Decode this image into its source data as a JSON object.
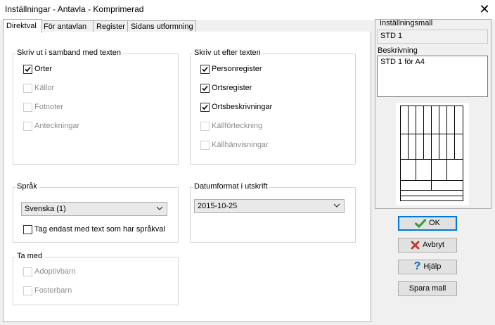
{
  "window": {
    "title": "Inställningar - Antavla - Komprimerad"
  },
  "tabs": [
    "Direktval",
    "För antavlan",
    "Register",
    "Sidans utformning"
  ],
  "groups": {
    "samband": {
      "label": "Skriv ut i samband med texten",
      "items": [
        {
          "label": "Orter",
          "checked": true,
          "enabled": true
        },
        {
          "label": "Källor",
          "checked": false,
          "enabled": false
        },
        {
          "label": "Fotnoter",
          "checked": false,
          "enabled": false
        },
        {
          "label": "Anteckningar",
          "checked": false,
          "enabled": false
        }
      ]
    },
    "efter": {
      "label": "Skriv ut efter texten",
      "items": [
        {
          "label": "Personregister",
          "checked": true,
          "enabled": true
        },
        {
          "label": "Ortsregister",
          "checked": true,
          "enabled": true
        },
        {
          "label": "Ortsbeskrivningar",
          "checked": true,
          "enabled": true
        },
        {
          "label": "Källförteckning",
          "checked": false,
          "enabled": false
        },
        {
          "label": "Källhänvisningar",
          "checked": false,
          "enabled": false
        }
      ]
    },
    "sprak": {
      "label": "Språk",
      "selected": "Svenska (1)",
      "checkbox": {
        "label": "Tag endast med text som har språkval",
        "checked": false,
        "enabled": true
      }
    },
    "datum": {
      "label": "Datumformat i utskrift",
      "selected": "2015-10-25"
    },
    "tamed": {
      "label": "Ta med",
      "items": [
        {
          "label": "Adoptivbarn",
          "checked": false,
          "enabled": false
        },
        {
          "label": "Fosterbarn",
          "checked": false,
          "enabled": false
        }
      ]
    }
  },
  "template": {
    "label": "Inställningsmall",
    "value": "STD 1",
    "desc_label": "Beskrivning",
    "desc_value": "STD 1 för A4"
  },
  "buttons": {
    "ok": "OK",
    "cancel": "Avbryt",
    "help": "Hjälp",
    "save": "Spara mall"
  },
  "colors": {
    "ok_check": "#2e9e2e",
    "cancel_x": "#c0392b",
    "help_q": "#1565c0",
    "focus_border": "#0078d7"
  }
}
